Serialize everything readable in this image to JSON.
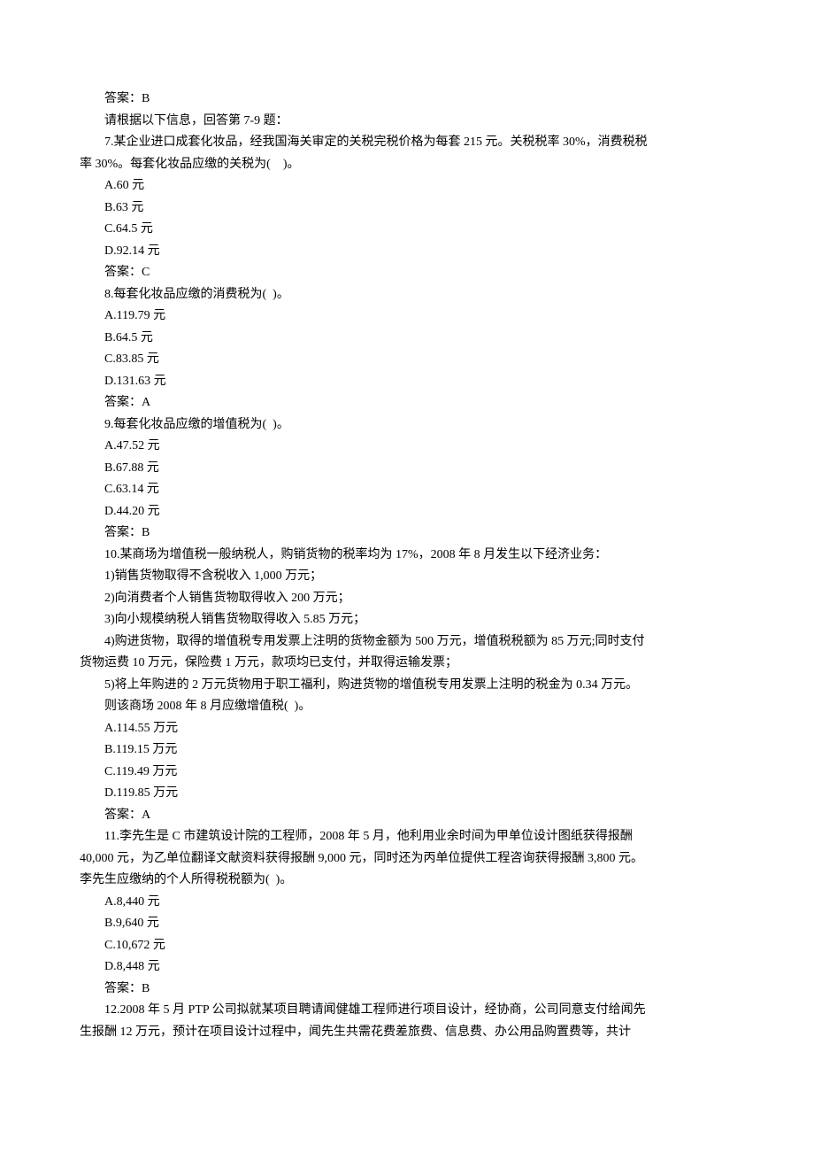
{
  "lines": [
    {
      "indent": true,
      "text": "答案：B"
    },
    {
      "indent": true,
      "text": "请根据以下信息，回答第 7-9 题："
    },
    {
      "indent": true,
      "text": "7.某企业进口成套化妆品，经我国海关审定的关税完税价格为每套 215 元。关税税率 30%，消费税税"
    },
    {
      "indent": false,
      "text": "率 30%。每套化妆品应缴的关税为(　)。"
    },
    {
      "indent": true,
      "text": "A.60 元"
    },
    {
      "indent": true,
      "text": "B.63 元"
    },
    {
      "indent": true,
      "text": "C.64.5 元"
    },
    {
      "indent": true,
      "text": "D.92.14 元"
    },
    {
      "indent": true,
      "text": "答案：C"
    },
    {
      "indent": true,
      "text": "8.每套化妆品应缴的消费税为(  )。"
    },
    {
      "indent": true,
      "text": "A.119.79 元"
    },
    {
      "indent": true,
      "text": "B.64.5 元"
    },
    {
      "indent": true,
      "text": "C.83.85 元"
    },
    {
      "indent": true,
      "text": "D.131.63 元"
    },
    {
      "indent": true,
      "text": "答案：A"
    },
    {
      "indent": true,
      "text": "9.每套化妆品应缴的增值税为(  )。"
    },
    {
      "indent": true,
      "text": "A.47.52 元"
    },
    {
      "indent": true,
      "text": "B.67.88 元"
    },
    {
      "indent": true,
      "text": "C.63.14 元"
    },
    {
      "indent": true,
      "text": "D.44.20 元"
    },
    {
      "indent": true,
      "text": "答案：B"
    },
    {
      "indent": true,
      "text": "10.某商场为增值税一般纳税人，购销货物的税率均为 17%，2008 年 8 月发生以下经济业务："
    },
    {
      "indent": true,
      "text": "1)销售货物取得不含税收入 1,000 万元；"
    },
    {
      "indent": true,
      "text": "2)向消费者个人销售货物取得收入 200 万元；"
    },
    {
      "indent": true,
      "text": "3)向小规模纳税人销售货物取得收入 5.85 万元；"
    },
    {
      "indent": true,
      "text": "4)购进货物，取得的增值税专用发票上注明的货物金额为 500 万元，增值税税额为 85 万元;同时支付"
    },
    {
      "indent": false,
      "text": "货物运费 10 万元，保险费 1 万元，款项均已支付，并取得运输发票；"
    },
    {
      "indent": true,
      "text": "5)将上年购进的 2 万元货物用于职工福利，购进货物的增值税专用发票上注明的税金为 0.34 万元。"
    },
    {
      "indent": true,
      "text": "则该商场 2008 年 8 月应缴增值税(  )。"
    },
    {
      "indent": true,
      "text": "A.114.55 万元"
    },
    {
      "indent": true,
      "text": "B.119.15 万元"
    },
    {
      "indent": true,
      "text": "C.119.49 万元"
    },
    {
      "indent": true,
      "text": "D.119.85 万元"
    },
    {
      "indent": true,
      "text": "答案：A"
    },
    {
      "indent": true,
      "text": "11.李先生是 C 市建筑设计院的工程师，2008 年 5 月，他利用业余时间为甲单位设计图纸获得报酬"
    },
    {
      "indent": false,
      "text": "40,000 元，为乙单位翻译文献资料获得报酬 9,000 元，同时还为丙单位提供工程咨询获得报酬 3,800 元。"
    },
    {
      "indent": false,
      "text": "李先生应缴纳的个人所得税税额为(  )。"
    },
    {
      "indent": true,
      "text": "A.8,440 元"
    },
    {
      "indent": true,
      "text": "B.9,640 元"
    },
    {
      "indent": true,
      "text": "C.10,672 元"
    },
    {
      "indent": true,
      "text": "D.8,448 元"
    },
    {
      "indent": true,
      "text": "答案：B"
    },
    {
      "indent": true,
      "text": "12.2008 年 5 月 PTP 公司拟就某项目聘请闻健雄工程师进行项目设计，经协商，公司同意支付给闻先"
    },
    {
      "indent": false,
      "text": "生报酬 12 万元，预计在项目设计过程中，闻先生共需花费差旅费、信息费、办公用品购置费等，共计"
    }
  ]
}
